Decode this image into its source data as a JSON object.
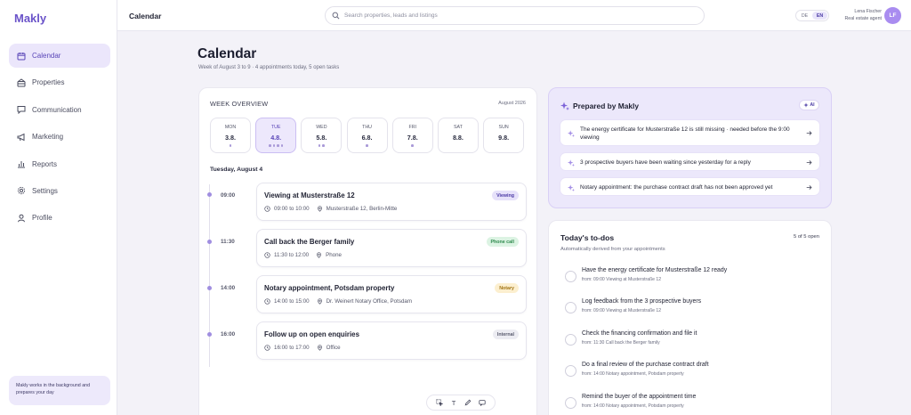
{
  "app": {
    "name": "Makly"
  },
  "sidebar": {
    "items": [
      {
        "label": "Calendar",
        "icon": "calendar-icon",
        "active": true
      },
      {
        "label": "Properties",
        "icon": "building-icon",
        "active": false
      },
      {
        "label": "Communication",
        "icon": "chat-icon",
        "active": false
      },
      {
        "label": "Marketing",
        "icon": "megaphone-icon",
        "active": false
      },
      {
        "label": "Reports",
        "icon": "bar-chart-icon",
        "active": false
      },
      {
        "label": "Settings",
        "icon": "gear-icon",
        "active": false
      },
      {
        "label": "Profile",
        "icon": "user-icon",
        "active": false
      }
    ],
    "note": "Makly works in the background and prepares your day"
  },
  "topbar": {
    "title": "Calendar",
    "search_placeholder": "Search properties, leads and listings",
    "languages": [
      "DE",
      "EN"
    ],
    "active_language": "EN",
    "user_name": "Lena Fischer",
    "user_role": "Real estate agent",
    "avatar_initials": "LF"
  },
  "page": {
    "title": "Calendar",
    "subtitle": "Week of August 3 to 9 · 4 appointments today, 5 open tasks"
  },
  "week": {
    "title": "WEEK OVERVIEW",
    "month": "August 2026",
    "days": [
      {
        "name": "MON",
        "date": "3.8.",
        "dots": 1,
        "selected": false
      },
      {
        "name": "TUE",
        "date": "4.8.",
        "dots": 4,
        "selected": true
      },
      {
        "name": "WED",
        "date": "5.8.",
        "dots": 2,
        "selected": false
      },
      {
        "name": "THU",
        "date": "6.8.",
        "dots": 1,
        "selected": false
      },
      {
        "name": "FRI",
        "date": "7.8.",
        "dots": 1,
        "selected": false
      },
      {
        "name": "SAT",
        "date": "8.8.",
        "dots": 0,
        "selected": false
      },
      {
        "name": "SUN",
        "date": "9.8.",
        "dots": 0,
        "selected": false
      }
    ],
    "day_label": "Tuesday, August 4",
    "appointments": [
      {
        "time": "09:00",
        "title": "Viewing at Musterstraße 12",
        "range": "09:00 to 10:00",
        "place": "Musterstraße 12, Berlin-Mitte",
        "tag": "Viewing",
        "tag_bg": "#e6e1fa",
        "tag_fg": "#4b3aa6"
      },
      {
        "time": "11:30",
        "title": "Call back the Berger family",
        "range": "11:30 to 12:00",
        "place": "Phone",
        "tag": "Phone call",
        "tag_bg": "#dcf3e3",
        "tag_fg": "#2f8a4d"
      },
      {
        "time": "14:00",
        "title": "Notary appointment, Potsdam property",
        "range": "14:00 to 15:00",
        "place": "Dr. Weinert Notary Office, Potsdam",
        "tag": "Notary",
        "tag_bg": "#fcefcf",
        "tag_fg": "#a27413"
      },
      {
        "time": "16:00",
        "title": "Follow up on open enquiries",
        "range": "16:00 to 17:00",
        "place": "Office",
        "tag": "Internal",
        "tag_bg": "#ececf2",
        "tag_fg": "#5a5c6e"
      }
    ],
    "toolbar": [
      "select-icon",
      "T",
      "pen-icon",
      "comment-icon"
    ]
  },
  "prepared": {
    "title": "Prepared by Makly",
    "badge": "AI",
    "items": [
      "The energy certificate for Musterstraße 12 is still missing · needed before the 9:00 viewing",
      "3 prospective buyers have been waiting since yesterday for a reply",
      "Notary appointment: the purchase contract draft has not been approved yet"
    ]
  },
  "todos": {
    "title": "Today's to-dos",
    "count": "5 of 5 open",
    "subtitle": "Automatically derived from your appointments",
    "items": [
      {
        "title": "Have the energy certificate for Musterstraße 12 ready",
        "from": "from: 09:00 Viewing at Musterstraße 12"
      },
      {
        "title": "Log feedback from the 3 prospective buyers",
        "from": "from: 09:00 Viewing at Musterstraße 12"
      },
      {
        "title": "Check the financing confirmation and file it",
        "from": "from: 11:30 Call back the Berger family"
      },
      {
        "title": "Do a final review of the purchase contract draft",
        "from": "from: 14:00 Notary appointment, Potsdam property"
      },
      {
        "title": "Remind the buyer of the appointment time",
        "from": "from: 14:00 Notary appointment, Potsdam property"
      }
    ]
  },
  "colors": {
    "accent": "#6a53c9",
    "accent_soft": "#ebe6fb",
    "background": "#f3f2f8"
  }
}
